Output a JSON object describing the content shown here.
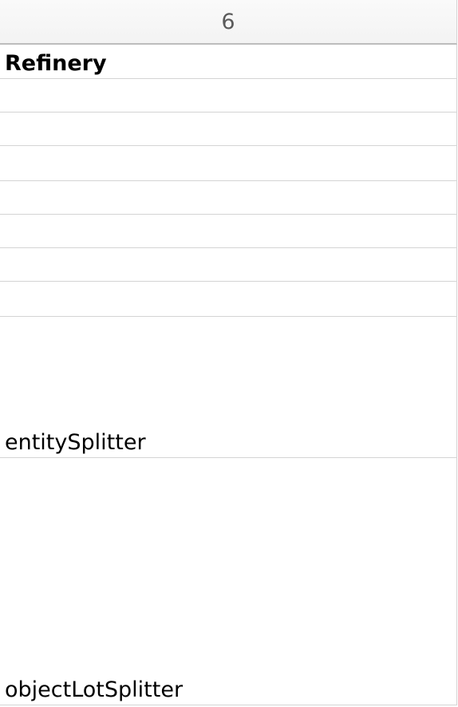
{
  "column_header": {
    "label": "6"
  },
  "cells": [
    {
      "text": "Refinery",
      "bold": true
    },
    {
      "text": ""
    },
    {
      "text": ""
    },
    {
      "text": ""
    },
    {
      "text": ""
    },
    {
      "text": ""
    },
    {
      "text": ""
    },
    {
      "text": ""
    },
    {
      "text": "entitySplitter"
    },
    {
      "text": "objectLotSplitter"
    }
  ]
}
